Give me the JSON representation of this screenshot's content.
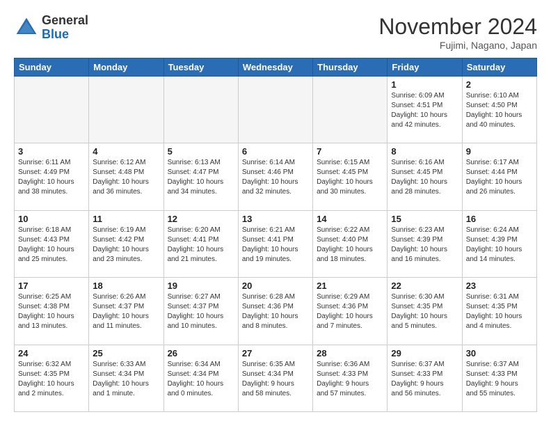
{
  "header": {
    "logo_general": "General",
    "logo_blue": "Blue",
    "month_title": "November 2024",
    "location": "Fujimi, Nagano, Japan"
  },
  "days_of_week": [
    "Sunday",
    "Monday",
    "Tuesday",
    "Wednesday",
    "Thursday",
    "Friday",
    "Saturday"
  ],
  "weeks": [
    [
      {
        "day": "",
        "info": "",
        "empty": true
      },
      {
        "day": "",
        "info": "",
        "empty": true
      },
      {
        "day": "",
        "info": "",
        "empty": true
      },
      {
        "day": "",
        "info": "",
        "empty": true
      },
      {
        "day": "",
        "info": "",
        "empty": true
      },
      {
        "day": "1",
        "info": "Sunrise: 6:09 AM\nSunset: 4:51 PM\nDaylight: 10 hours\nand 42 minutes."
      },
      {
        "day": "2",
        "info": "Sunrise: 6:10 AM\nSunset: 4:50 PM\nDaylight: 10 hours\nand 40 minutes."
      }
    ],
    [
      {
        "day": "3",
        "info": "Sunrise: 6:11 AM\nSunset: 4:49 PM\nDaylight: 10 hours\nand 38 minutes."
      },
      {
        "day": "4",
        "info": "Sunrise: 6:12 AM\nSunset: 4:48 PM\nDaylight: 10 hours\nand 36 minutes."
      },
      {
        "day": "5",
        "info": "Sunrise: 6:13 AM\nSunset: 4:47 PM\nDaylight: 10 hours\nand 34 minutes."
      },
      {
        "day": "6",
        "info": "Sunrise: 6:14 AM\nSunset: 4:46 PM\nDaylight: 10 hours\nand 32 minutes."
      },
      {
        "day": "7",
        "info": "Sunrise: 6:15 AM\nSunset: 4:45 PM\nDaylight: 10 hours\nand 30 minutes."
      },
      {
        "day": "8",
        "info": "Sunrise: 6:16 AM\nSunset: 4:45 PM\nDaylight: 10 hours\nand 28 minutes."
      },
      {
        "day": "9",
        "info": "Sunrise: 6:17 AM\nSunset: 4:44 PM\nDaylight: 10 hours\nand 26 minutes."
      }
    ],
    [
      {
        "day": "10",
        "info": "Sunrise: 6:18 AM\nSunset: 4:43 PM\nDaylight: 10 hours\nand 25 minutes."
      },
      {
        "day": "11",
        "info": "Sunrise: 6:19 AM\nSunset: 4:42 PM\nDaylight: 10 hours\nand 23 minutes."
      },
      {
        "day": "12",
        "info": "Sunrise: 6:20 AM\nSunset: 4:41 PM\nDaylight: 10 hours\nand 21 minutes."
      },
      {
        "day": "13",
        "info": "Sunrise: 6:21 AM\nSunset: 4:41 PM\nDaylight: 10 hours\nand 19 minutes."
      },
      {
        "day": "14",
        "info": "Sunrise: 6:22 AM\nSunset: 4:40 PM\nDaylight: 10 hours\nand 18 minutes."
      },
      {
        "day": "15",
        "info": "Sunrise: 6:23 AM\nSunset: 4:39 PM\nDaylight: 10 hours\nand 16 minutes."
      },
      {
        "day": "16",
        "info": "Sunrise: 6:24 AM\nSunset: 4:39 PM\nDaylight: 10 hours\nand 14 minutes."
      }
    ],
    [
      {
        "day": "17",
        "info": "Sunrise: 6:25 AM\nSunset: 4:38 PM\nDaylight: 10 hours\nand 13 minutes."
      },
      {
        "day": "18",
        "info": "Sunrise: 6:26 AM\nSunset: 4:37 PM\nDaylight: 10 hours\nand 11 minutes."
      },
      {
        "day": "19",
        "info": "Sunrise: 6:27 AM\nSunset: 4:37 PM\nDaylight: 10 hours\nand 10 minutes."
      },
      {
        "day": "20",
        "info": "Sunrise: 6:28 AM\nSunset: 4:36 PM\nDaylight: 10 hours\nand 8 minutes."
      },
      {
        "day": "21",
        "info": "Sunrise: 6:29 AM\nSunset: 4:36 PM\nDaylight: 10 hours\nand 7 minutes."
      },
      {
        "day": "22",
        "info": "Sunrise: 6:30 AM\nSunset: 4:35 PM\nDaylight: 10 hours\nand 5 minutes."
      },
      {
        "day": "23",
        "info": "Sunrise: 6:31 AM\nSunset: 4:35 PM\nDaylight: 10 hours\nand 4 minutes."
      }
    ],
    [
      {
        "day": "24",
        "info": "Sunrise: 6:32 AM\nSunset: 4:35 PM\nDaylight: 10 hours\nand 2 minutes."
      },
      {
        "day": "25",
        "info": "Sunrise: 6:33 AM\nSunset: 4:34 PM\nDaylight: 10 hours\nand 1 minute."
      },
      {
        "day": "26",
        "info": "Sunrise: 6:34 AM\nSunset: 4:34 PM\nDaylight: 10 hours\nand 0 minutes."
      },
      {
        "day": "27",
        "info": "Sunrise: 6:35 AM\nSunset: 4:34 PM\nDaylight: 9 hours\nand 58 minutes."
      },
      {
        "day": "28",
        "info": "Sunrise: 6:36 AM\nSunset: 4:33 PM\nDaylight: 9 hours\nand 57 minutes."
      },
      {
        "day": "29",
        "info": "Sunrise: 6:37 AM\nSunset: 4:33 PM\nDaylight: 9 hours\nand 56 minutes."
      },
      {
        "day": "30",
        "info": "Sunrise: 6:37 AM\nSunset: 4:33 PM\nDaylight: 9 hours\nand 55 minutes."
      }
    ]
  ]
}
